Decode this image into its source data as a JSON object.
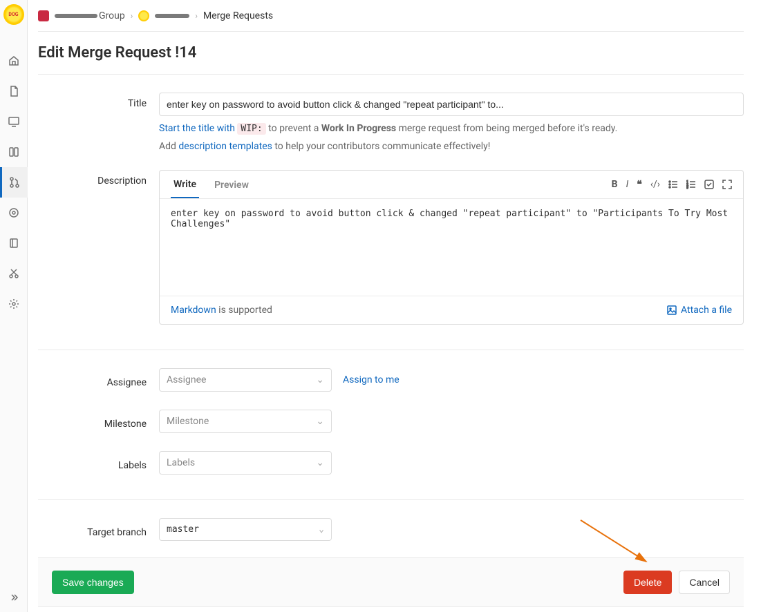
{
  "breadcrumbs": {
    "group_label": "Group",
    "current": "Merge Requests"
  },
  "page_title": "Edit Merge Request !14",
  "title": {
    "label": "Title",
    "value": "enter key on password to avoid button click & changed \"repeat participant\" to...",
    "hint_pre": "Start the title with ",
    "wip_code": "WIP:",
    "hint_mid": " to prevent a ",
    "hint_bold": "Work In Progress",
    "hint_post": " merge request from being merged before it's ready."
  },
  "template_hint": {
    "pre": "Add ",
    "link": "description templates",
    "post": " to help your contributors communicate effectively!"
  },
  "description": {
    "label": "Description",
    "tab_write": "Write",
    "tab_preview": "Preview",
    "value": "enter key on password to avoid button click & changed \"repeat participant\" to \"Participants To Try Most Challenges\"",
    "markdown_link": "Markdown",
    "markdown_post": " is supported",
    "attach": "Attach a file"
  },
  "assignee": {
    "label": "Assignee",
    "placeholder": "Assignee",
    "assign_me": "Assign to me"
  },
  "milestone": {
    "label": "Milestone",
    "placeholder": "Milestone"
  },
  "labels_field": {
    "label": "Labels",
    "placeholder": "Labels"
  },
  "target_branch": {
    "label": "Target branch",
    "value": "master"
  },
  "buttons": {
    "save": "Save changes",
    "delete": "Delete",
    "cancel": "Cancel"
  }
}
